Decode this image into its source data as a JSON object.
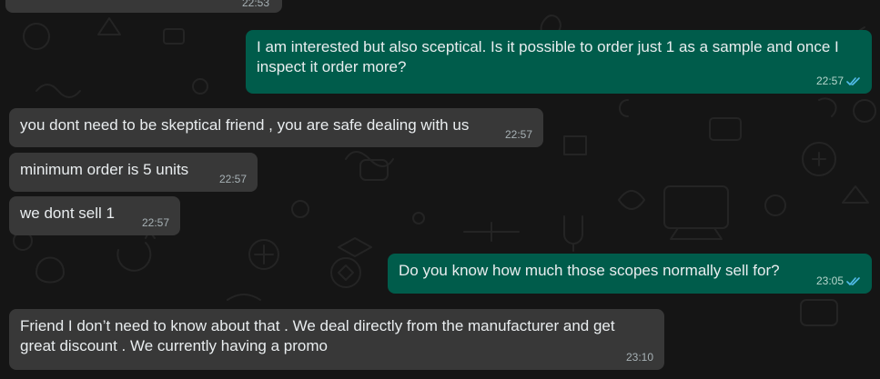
{
  "chat": {
    "messages": [
      {
        "id": "m0",
        "direction": "in",
        "text": "",
        "time": "22:53",
        "partial": true
      },
      {
        "id": "m1",
        "direction": "out",
        "text": "I am interested but also sceptical. Is it possible to order just 1 as a sample and once I inspect it order more?",
        "time": "22:57",
        "status": "read"
      },
      {
        "id": "m2",
        "direction": "in",
        "text": "you dont need to be skeptical friend , you are safe dealing with us",
        "time": "22:57"
      },
      {
        "id": "m3",
        "direction": "in",
        "text": "minimum order is 5 units",
        "time": "22:57"
      },
      {
        "id": "m4",
        "direction": "in",
        "text": "we dont sell 1",
        "time": "22:57"
      },
      {
        "id": "m5",
        "direction": "out",
        "text": "Do you know how much those scopes normally sell for?",
        "time": "23:05",
        "status": "read"
      },
      {
        "id": "m6",
        "direction": "in",
        "text": "Friend I don’t need to know about that . We deal directly from the manufacturer and get great discount . We currently having a promo",
        "time": "23:10"
      }
    ]
  },
  "colors": {
    "background": "#151515",
    "incoming_bubble": "#383838",
    "outgoing_bubble": "#005c4b",
    "read_ticks": "#53bdeb",
    "text": "#e9edef"
  },
  "icons": {
    "read_receipt": "double-check-icon"
  }
}
